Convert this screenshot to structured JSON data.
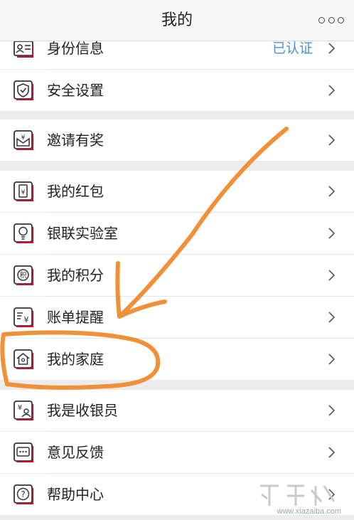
{
  "nav": {
    "title": "我的"
  },
  "groups": [
    {
      "items": [
        {
          "name": "identity-info",
          "label": "身份信息",
          "value": "已认证",
          "icon": "id-card-icon"
        },
        {
          "name": "security-settings",
          "label": "安全设置",
          "icon": "shield-icon"
        }
      ]
    },
    {
      "items": [
        {
          "name": "invite-reward",
          "label": "邀请有奖",
          "icon": "gift-envelope-icon"
        }
      ]
    },
    {
      "items": [
        {
          "name": "my-red-packet",
          "label": "我的红包",
          "icon": "red-packet-icon"
        },
        {
          "name": "unionpay-lab",
          "label": "银联实验室",
          "icon": "lightbulb-icon"
        },
        {
          "name": "my-points",
          "label": "我的积分",
          "icon": "points-icon"
        },
        {
          "name": "bill-reminder",
          "label": "账单提醒",
          "icon": "bill-icon"
        },
        {
          "name": "my-family",
          "label": "我的家庭",
          "icon": "house-icon"
        }
      ]
    },
    {
      "items": [
        {
          "name": "i-am-cashier",
          "label": "我是收银员",
          "icon": "cashier-icon"
        },
        {
          "name": "feedback",
          "label": "意见反馈",
          "icon": "chat-bubble-icon"
        },
        {
          "name": "help-center",
          "label": "帮助中心",
          "icon": "question-icon"
        }
      ]
    }
  ],
  "watermark": {
    "text": "www.xiazaiba.com"
  },
  "colors": {
    "accent": "#c8102e",
    "link": "#4a90d9",
    "annotation": "#f0913a"
  }
}
